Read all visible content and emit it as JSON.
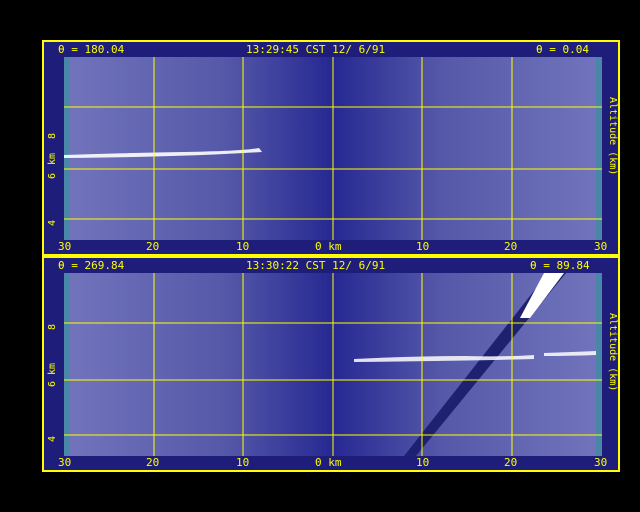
{
  "panels": [
    {
      "theta_left": "θ = 180.04",
      "timestamp": "13:29:45 CST 12/ 6/91",
      "theta_right": "θ = 0.04",
      "xticks": [
        "30",
        "20",
        "10",
        "0 km",
        "10",
        "20",
        "30"
      ],
      "yticks": [
        "4",
        "6",
        "8"
      ],
      "ylabel_left": "km",
      "ylabel_right": "Altitude (km)"
    },
    {
      "theta_left": "θ = 269.84",
      "timestamp": "13:30:22 CST 12/ 6/91",
      "theta_right": "θ = 89.84",
      "xticks": [
        "30",
        "20",
        "10",
        "0 km",
        "10",
        "20",
        "30"
      ],
      "yticks": [
        "4",
        "6",
        "8"
      ],
      "ylabel_left": "km",
      "ylabel_right": "Altitude (km)"
    }
  ],
  "colors": {
    "frame": "#ffff00",
    "background": "#000000",
    "plot_bg": "#2a2c90",
    "cloud": "#ffffff"
  }
}
